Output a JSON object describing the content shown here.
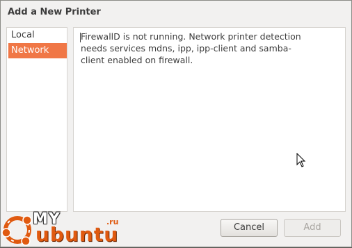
{
  "window": {
    "title": "Add a New Printer"
  },
  "sidebar": {
    "items": [
      {
        "label": "Local",
        "selected": false
      },
      {
        "label": "Network",
        "selected": true
      }
    ]
  },
  "content": {
    "message": "FirewallD is not running. Network printer detection needs services mdns, ipp, ipp-client and samba-client enabled on firewall."
  },
  "buttons": {
    "cancel_label": "Cancel",
    "add_label": "Add",
    "add_enabled": false
  },
  "watermark": {
    "my": "MY",
    "ubuntu": "ubuntu",
    "ru": ".ru"
  },
  "colors": {
    "accent": "#f07746",
    "brand": "#e05a10"
  }
}
